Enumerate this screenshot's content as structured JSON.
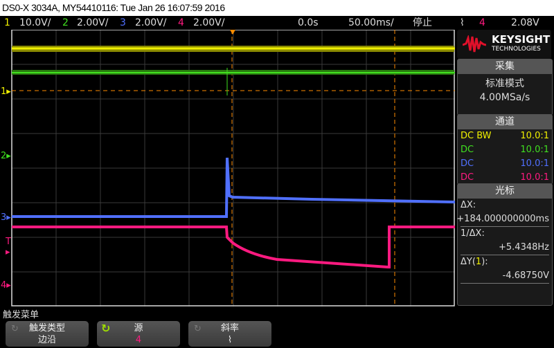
{
  "title": "DS0-X 3034A, MY54410116: Tue Jan 26 16:07:59 2016",
  "channels": [
    {
      "num": "1",
      "scale": "10.0V/",
      "color": "#f0f000"
    },
    {
      "num": "2",
      "scale": "2.00V/",
      "color": "#40e020"
    },
    {
      "num": "3",
      "scale": "2.00V/",
      "color": "#5070ff"
    },
    {
      "num": "4",
      "scale": "2.00V/",
      "color": "#ff1a80"
    }
  ],
  "timebase": {
    "delay": "0.0s",
    "scale": "50.00ms/",
    "run_state": "停止"
  },
  "trigger": {
    "slope_icon": "falling-edge",
    "source": "4",
    "level": "2.08V",
    "marker": "T"
  },
  "brand": {
    "name": "KEYSIGHT",
    "sub": "TECHNOLOGIES",
    "color": "#e0102a"
  },
  "acquire": {
    "header": "采集",
    "mode": "标准模式",
    "rate": "4.00MSa/s"
  },
  "channel_panel": {
    "header": "通道",
    "rows": [
      {
        "coupling": "DC BW",
        "probe": "10.0:1"
      },
      {
        "coupling": "DC",
        "probe": "10.0:1"
      },
      {
        "coupling": "DC",
        "probe": "10.0:1"
      },
      {
        "coupling": "DC",
        "probe": "10.0:1"
      }
    ]
  },
  "cursors": {
    "header": "光标",
    "dx_label": "ΔX:",
    "dx": "+184.000000000ms",
    "inv_label": "1/ΔX:",
    "inv": "+5.4348Hz",
    "dy_label_pre": "ΔY(",
    "dy_ch": "1",
    "dy_label_end": "):",
    "dy": "-4.68750V"
  },
  "menu": {
    "title": "触发菜单",
    "keys": [
      {
        "label": "触发类型",
        "value": "边沿"
      },
      {
        "label": "源",
        "value": "4"
      },
      {
        "label": "斜率",
        "value": "⌇"
      }
    ]
  }
}
